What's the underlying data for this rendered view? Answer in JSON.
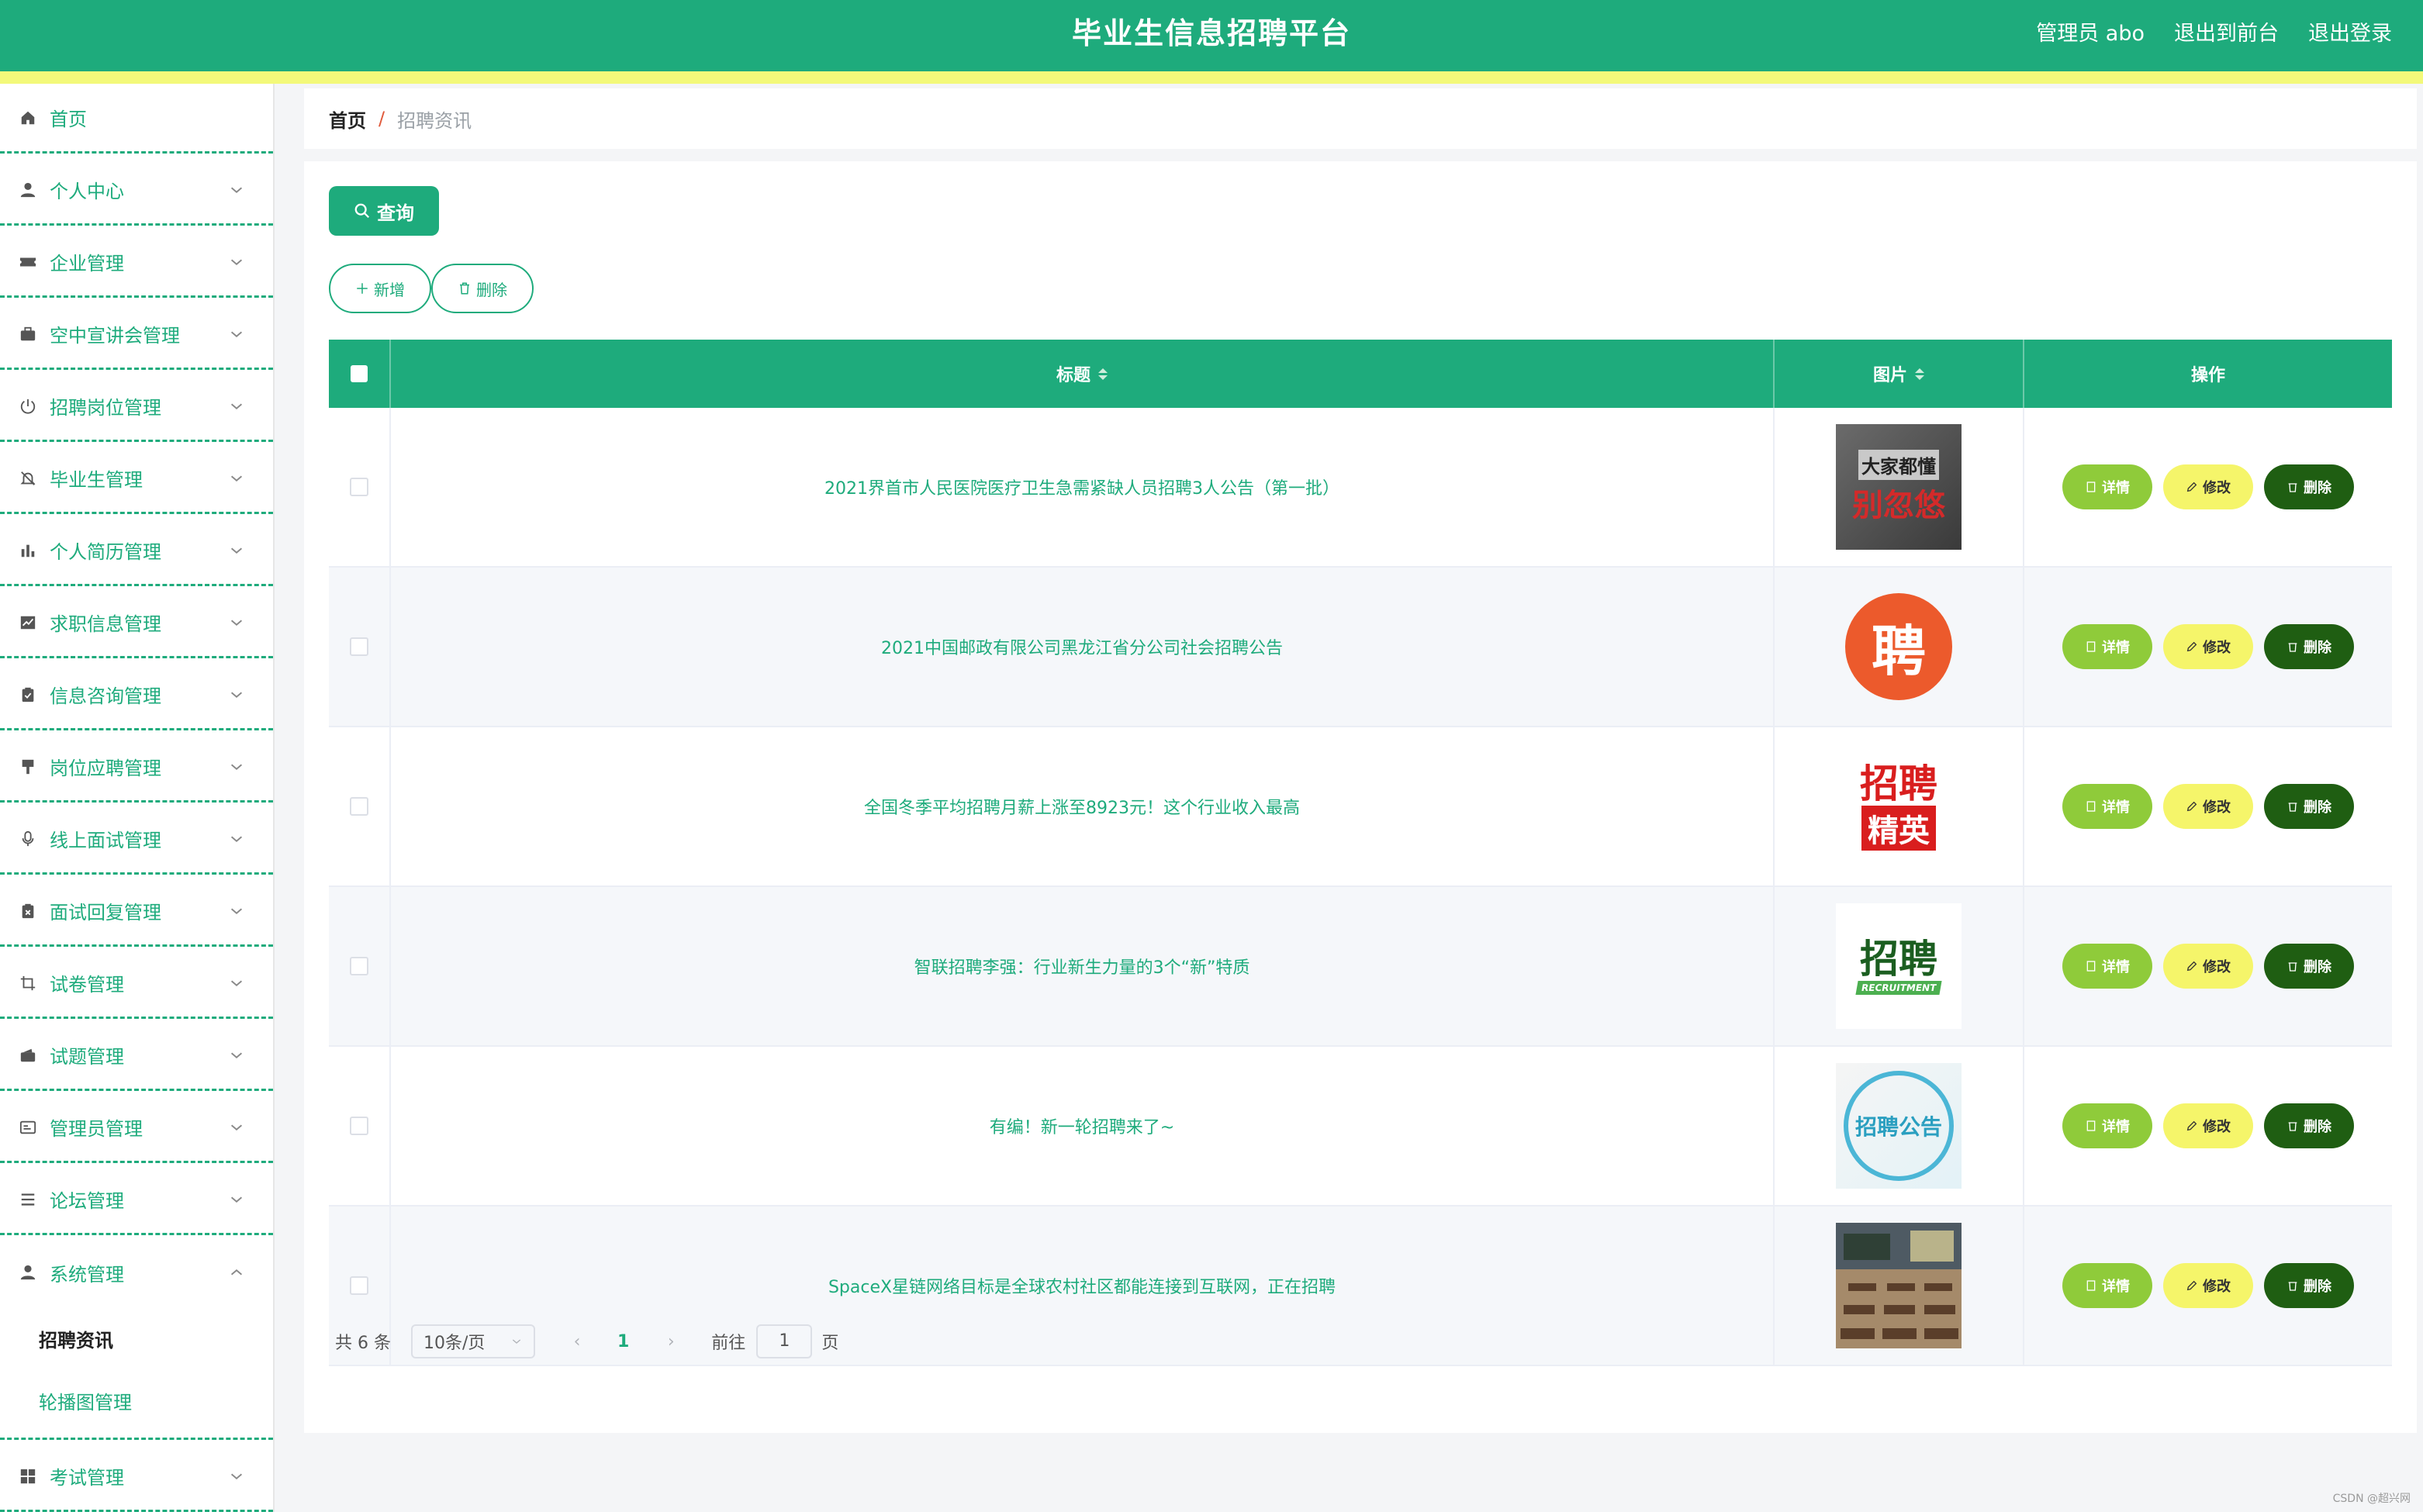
{
  "header": {
    "title": "毕业生信息招聘平台",
    "user": "管理员 abo",
    "front_link": "退出到前台",
    "logout_link": "退出登录"
  },
  "sidebar": {
    "items": [
      {
        "label": "首页",
        "icon": "home-icon",
        "has_submenu": false
      },
      {
        "label": "个人中心",
        "icon": "user-icon",
        "has_submenu": true
      },
      {
        "label": "企业管理",
        "icon": "ticket-icon",
        "has_submenu": true
      },
      {
        "label": "空中宣讲会管理",
        "icon": "briefcase-icon",
        "has_submenu": true
      },
      {
        "label": "招聘岗位管理",
        "icon": "power-icon",
        "has_submenu": true
      },
      {
        "label": "毕业生管理",
        "icon": "bell-off-icon",
        "has_submenu": true
      },
      {
        "label": "个人简历管理",
        "icon": "bar-chart-icon",
        "has_submenu": true
      },
      {
        "label": "求职信息管理",
        "icon": "trend-chart-icon",
        "has_submenu": true
      },
      {
        "label": "信息咨询管理",
        "icon": "clipboard-check-icon",
        "has_submenu": true
      },
      {
        "label": "岗位应聘管理",
        "icon": "brush-icon",
        "has_submenu": true
      },
      {
        "label": "线上面试管理",
        "icon": "microphone-icon",
        "has_submenu": true
      },
      {
        "label": "面试回复管理",
        "icon": "clipboard-x-icon",
        "has_submenu": true
      },
      {
        "label": "试卷管理",
        "icon": "crop-icon",
        "has_submenu": true
      },
      {
        "label": "试题管理",
        "icon": "wallet-icon",
        "has_submenu": true
      },
      {
        "label": "管理员管理",
        "icon": "id-card-icon",
        "has_submenu": true
      },
      {
        "label": "论坛管理",
        "icon": "list-icon",
        "has_submenu": true
      },
      {
        "label": "系统管理",
        "icon": "user-icon",
        "has_submenu": true,
        "expanded": true
      },
      {
        "label": "考试管理",
        "icon": "grid-icon",
        "has_submenu": true
      }
    ],
    "system_submenu": [
      {
        "label": "招聘资讯",
        "active": true
      },
      {
        "label": "轮播图管理",
        "active": false
      }
    ]
  },
  "breadcrumb": {
    "home": "首页",
    "separator": "/",
    "current": "招聘资讯"
  },
  "toolbar": {
    "query_label": "查询",
    "add_label": "新增",
    "delete_label": "删除"
  },
  "table": {
    "columns": {
      "title": "标题",
      "image": "图片",
      "actions": "操作"
    },
    "actions": {
      "detail": "详情",
      "edit": "修改",
      "delete": "删除"
    },
    "rows": [
      {
        "title": "2021界首市人民医院医疗卫生急需紧缺人员招聘3人公告（第一批）",
        "image": "poster-dark-icon",
        "image_text": "别忽悠",
        "image_top": "大家都懂"
      },
      {
        "title": "2021中国邮政有限公司黑龙江省分公司社会招聘公告",
        "image": "orange-circle-icon",
        "image_text": "聘"
      },
      {
        "title": "全国冬季平均招聘月薪上涨至8923元！这个行业收入最高",
        "image": "red-recruit-icon",
        "image_text": "招聘",
        "image_top": "精英"
      },
      {
        "title": "智联招聘李强：行业新生力量的3个“新”特质",
        "image": "green-arrow-icon",
        "image_text": "招聘",
        "image_top": "RECRUITMENT"
      },
      {
        "title": "有编！新一轮招聘来了~",
        "image": "pencils-notice-icon",
        "image_text": "招聘公告"
      },
      {
        "title": "SpaceX星链网络目标是全球农村社区都能连接到互联网，正在招聘",
        "image": "classroom-icon"
      }
    ]
  },
  "pagination": {
    "total": "共 6 条",
    "page_size": "10条/页",
    "current_page": "1",
    "goto_label": "前往",
    "goto_value": "1",
    "goto_unit": "页"
  },
  "watermark": "CSDN @超兴网",
  "colors": {
    "primary": "#1eab7c",
    "strip": "#f3f97a",
    "detail": "#8fcb3a",
    "edit": "#f5f56a",
    "delete": "#1f5e12"
  }
}
